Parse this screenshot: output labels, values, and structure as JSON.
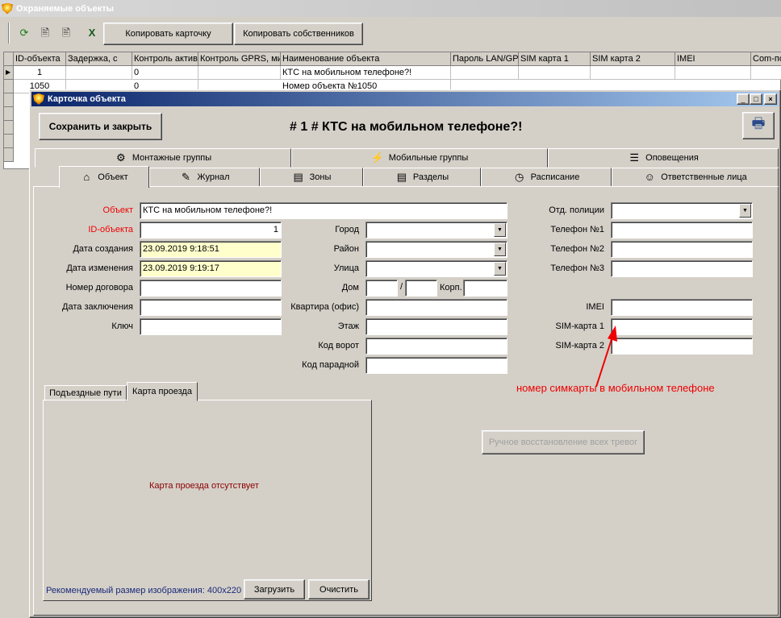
{
  "main_window": {
    "title": "Охраняемые объекты"
  },
  "toolbar": {
    "copy_card": "Копировать карточку",
    "copy_owners": "Копировать собственников"
  },
  "grid": {
    "columns": [
      "ID-объекта",
      "Задержка, с",
      "Контроль актив",
      "Контроль GPRS, ми",
      "Наименование объекта",
      "Пароль LAN/GP",
      "SIM карта 1",
      "SIM карта 2",
      "IMEI",
      "Com-по"
    ],
    "rows": [
      [
        "1",
        "",
        "0",
        "",
        "КТС на мобильном телефоне?!",
        "",
        "",
        "",
        "",
        ""
      ],
      [
        "1050",
        "",
        "0",
        "",
        "Номер объекта №1050",
        "",
        "",
        "",
        "",
        ""
      ]
    ]
  },
  "card": {
    "title": "Карточка объекта",
    "save_close": "Сохранить и закрыть",
    "heading": "# 1 # КТС на мобильном телефоне?!",
    "tabs_top": [
      "Монтажные группы",
      "Мобильные группы",
      "Оповещения"
    ],
    "tabs_bottom": [
      "Объект",
      "Журнал",
      "Зоны",
      "Разделы",
      "Расписание",
      "Ответственные лица"
    ],
    "fields": {
      "object_label": "Объект",
      "object_value": "КТС на мобильном телефоне?!",
      "id_label": "ID-объекта",
      "id_value": "1",
      "created_label": "Дата создания",
      "created_value": "23.09.2019 9:18:51",
      "modified_label": "Дата изменения",
      "modified_value": "23.09.2019 9:19:17",
      "contract_label": "Номер договора",
      "contract_date_label": "Дата заключения",
      "key_label": "Ключ",
      "city_label": "Город",
      "district_label": "Район",
      "street_label": "Улица",
      "house_label": "Дом",
      "house_sep": "/",
      "corp_label": "Корп.",
      "apartment_label": "Квартира (офис)",
      "floor_label": "Этаж",
      "gate_label": "Код ворот",
      "entrance_label": "Код парадной",
      "police_label": "Отд. полиции",
      "phone1_label": "Телефон №1",
      "phone2_label": "Телефон №2",
      "phone3_label": "Телефон №3",
      "imei_label": "IMEI",
      "sim1_label": "SIM-карта 1",
      "sim2_label": "SIM-карта 2"
    },
    "annotation": "номер симкарты в мобильном телефоне",
    "map_tabs": [
      "Подъездные пути",
      "Карта проезда"
    ],
    "map_missing": "Карта проезда отсутствует",
    "map_hint": "Рекомендуемый размер изображения: 400x220",
    "load": "Загрузить",
    "clear": "Очистить",
    "restore_alarms": "Ручное восстановление всех тревог"
  }
}
